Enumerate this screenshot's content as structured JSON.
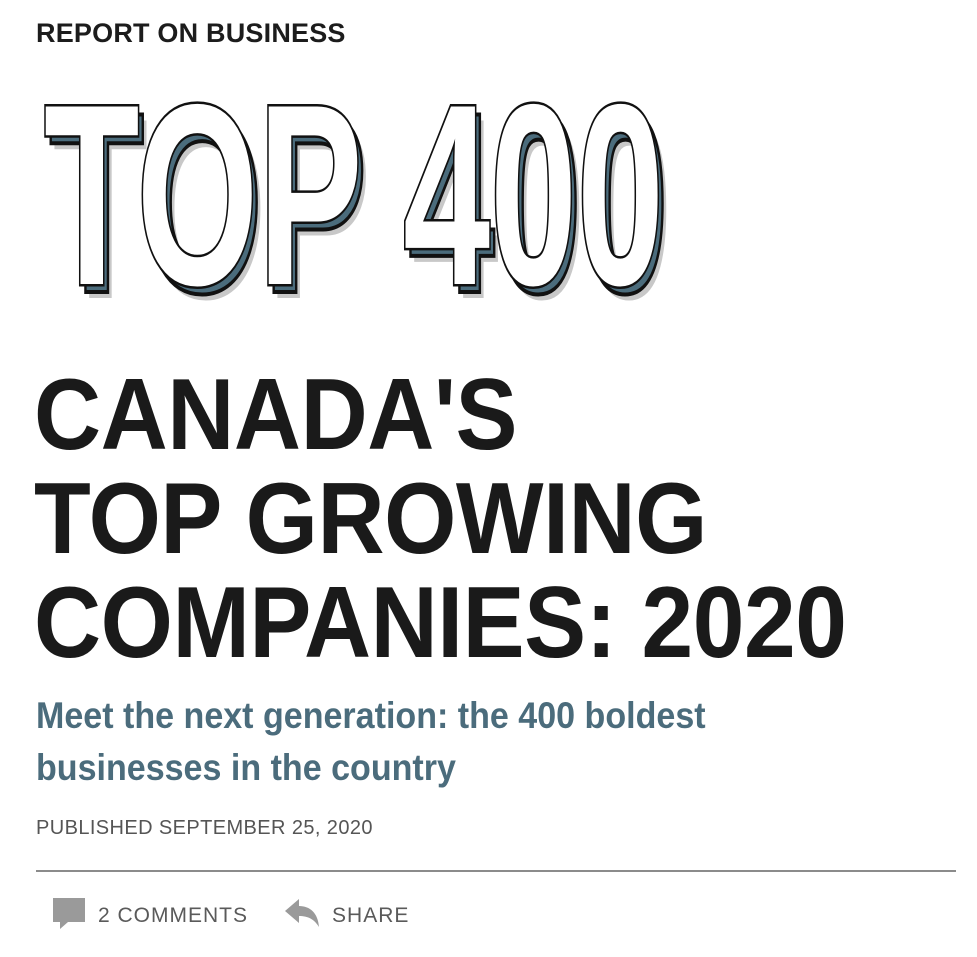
{
  "section_label": "REPORT ON BUSINESS",
  "logo": {
    "text": "TOP 400",
    "face_color": "#ffffff",
    "outline_color": "#111111",
    "shadow_color": "#4b6c7c",
    "soft_shadow_color": "#c8c8c8"
  },
  "headline": {
    "line1": "CANADA'S",
    "line2": "TOP GROWING",
    "line3": "COMPANIES: 2020"
  },
  "subhead": {
    "line1": "Meet the next generation: the 400 boldest",
    "line2": "businesses in the country",
    "color": "#4b6c7c"
  },
  "published": "PUBLISHED SEPTEMBER 25, 2020",
  "actions": {
    "comments_label": "2 COMMENTS",
    "comments_icon": "comment-icon",
    "share_label": "SHARE",
    "share_icon": "share-arrow-icon"
  }
}
